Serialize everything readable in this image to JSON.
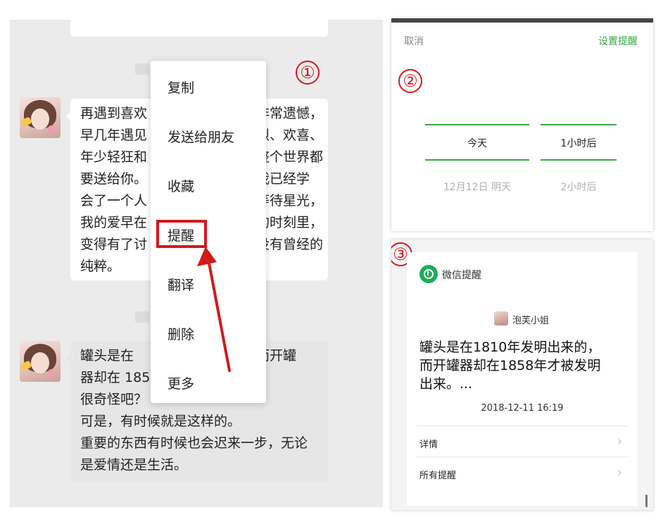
{
  "panel1": {
    "step": "①",
    "message1_lines": [
      "再遇到喜欢",
      "早几年遇见",
      "年少轻狂和",
      "要送给你。",
      "会了一个人",
      "我的爱早在",
      "变得有了讨",
      "纯粹。"
    ],
    "message1_right_lines": [
      "非常遗憾，",
      "烈、欢喜、",
      "整个世界都",
      "我已经学",
      "等待星光，",
      "的时刻里，",
      "没有曾经的"
    ],
    "message2_lines": [
      "罐头是在",
      "器却在 185",
      "很奇怪吧？",
      "可是，有时候就是这样的。",
      "重要的东西有时候也会迟来一步，无论",
      "是爱情还是生活。"
    ],
    "message2_right_line": "而开罐",
    "menu": [
      {
        "label": "复制"
      },
      {
        "label": "发送给朋友"
      },
      {
        "label": "收藏"
      },
      {
        "label": "提醒"
      },
      {
        "label": "翻译"
      },
      {
        "label": "删除"
      },
      {
        "label": "更多"
      }
    ],
    "highlight_color": "#d11a1a"
  },
  "panel2": {
    "step": "②",
    "cancel_label": "取消",
    "confirm_label": "设置提醒",
    "date_selected": "今天",
    "date_next": "12月12日 明天",
    "time_selected": "1小时后",
    "time_next": "2小时后",
    "accent_color": "#3aa548"
  },
  "panel3": {
    "step": "③",
    "app_name": "微信提醒",
    "sender": "泡芙小姐",
    "content": [
      "罐头是在1810年发明出来的，",
      "而开罐器却在1858年才被发明",
      "出来。..."
    ],
    "timestamp": "2018-12-11 16:19",
    "details_label": "详情",
    "all_reminders_label": "所有提醒",
    "icon": "alarm-clock-icon"
  }
}
